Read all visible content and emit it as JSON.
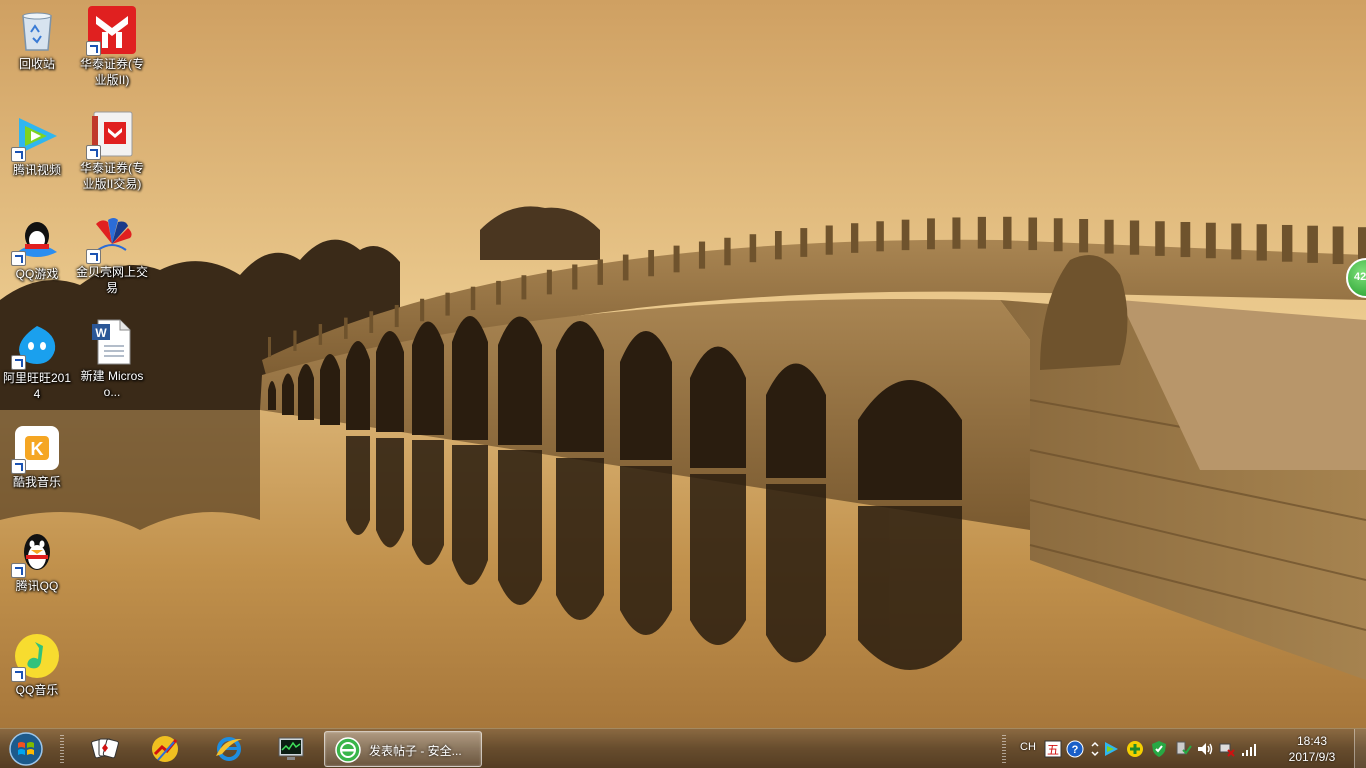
{
  "desktop": {
    "icons": [
      {
        "label": "回收站",
        "icon": "recycle-bin-icon"
      },
      {
        "label": "腾讯视频",
        "icon": "tencent-video-icon"
      },
      {
        "label": "QQ游戏",
        "icon": "qq-game-icon"
      },
      {
        "label": "阿里旺旺2014",
        "icon": "aliwangwang-icon"
      },
      {
        "label": "酷我音乐",
        "icon": "kuwo-music-icon"
      },
      {
        "label": "腾讯QQ",
        "icon": "qq-penguin-icon"
      },
      {
        "label": "QQ音乐",
        "icon": "qq-music-icon"
      },
      {
        "label": "华泰证券(专业版II)",
        "icon": "huatai-securities-icon"
      },
      {
        "label": "华泰证券(专业版II交易)",
        "icon": "huatai-trade-icon"
      },
      {
        "label": "金贝壳网上交易",
        "icon": "jinbeike-icon"
      },
      {
        "label": "新建 Microso...",
        "icon": "word-document-icon"
      }
    ],
    "float_badge": "42"
  },
  "taskbar": {
    "pinned": [
      {
        "name": "solitaire-cards-icon"
      },
      {
        "name": "stock-software-icon"
      },
      {
        "name": "internet-explorer-icon"
      },
      {
        "name": "task-manager-icon"
      }
    ],
    "active_task": {
      "label": "发表帖子 - 安全...",
      "icon": "secure-browser-icon"
    },
    "tray": {
      "language": "CH",
      "time": "18:43",
      "date": "2017/9/3"
    }
  },
  "colors": {
    "sky_top": "#d6a765",
    "sky_bottom": "#f3d59b",
    "bridge_stone": "#8c6b3e",
    "taskbar": "#5f462a"
  }
}
